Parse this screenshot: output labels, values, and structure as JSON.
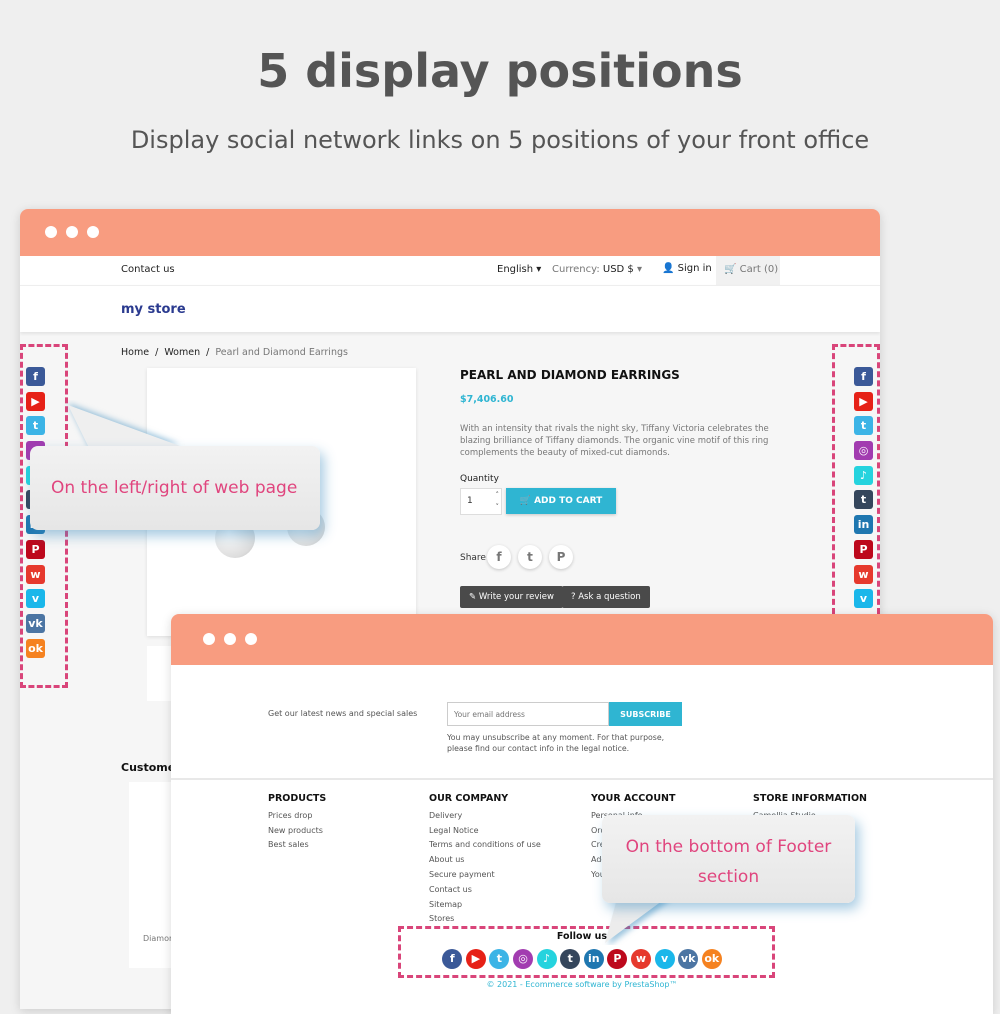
{
  "headline": {
    "title": "5 display positions",
    "subtitle": "Display social network links on 5 positions of your front office"
  },
  "colors": {
    "window_header": "#f89c80",
    "accent": "#2fb5d2",
    "callout_text": "#e0457e",
    "dash": "#d9457a"
  },
  "store": {
    "contact": "Contact us",
    "language": "English",
    "currency_label": "Currency:",
    "currency": "USD $",
    "sign_in": "Sign in",
    "cart": "Cart (0)",
    "logo": "my store",
    "breadcrumb": [
      "Home",
      "Women",
      "Pearl and Diamond Earrings"
    ],
    "product": {
      "name": "PEARL AND DIAMOND EARRINGS",
      "price": "$7,406.60",
      "description": "With an intensity that rivals the night sky, Tiffany Victoria celebrates the blazing brilliance of Tiffany diamonds. The organic vine motif of this ring complements the beauty of mixed-cut diamonds.",
      "quantity_label": "Quantity",
      "quantity": "1",
      "add_to_cart": "ADD TO CART",
      "share": "Share",
      "review": "Write your review",
      "ask": "Ask a question"
    },
    "customers_heading": "Custome",
    "product_card": "Diamon"
  },
  "callouts": {
    "side": "On the left/right of web page",
    "footer": "On the bottom of Footer section"
  },
  "footer": {
    "newsletter_label": "Get our latest news and special sales",
    "email_placeholder": "Your email address",
    "subscribe": "SUBSCRIBE",
    "newsletter_note": "You may unsubscribe at any moment. For that purpose, please find our contact info in the legal notice.",
    "columns": [
      {
        "title": "PRODUCTS",
        "items": [
          "Prices drop",
          "New products",
          "Best sales"
        ]
      },
      {
        "title": "OUR COMPANY",
        "items": [
          "Delivery",
          "Legal Notice",
          "Terms and conditions of use",
          "About us",
          "Secure payment",
          "Contact us",
          "Sitemap",
          "Stores"
        ]
      },
      {
        "title": "YOUR ACCOUNT",
        "items": [
          "Personal info",
          "Ord",
          "Cred",
          "Add",
          "You"
        ]
      },
      {
        "title": "STORE INFORMATION",
        "items": [
          "Camellia Studio",
          "",
          "nail.com"
        ]
      }
    ],
    "follow_us": "Follow us",
    "copyright": "© 2021 - Ecommerce software by PrestaShop™"
  },
  "social": [
    {
      "name": "facebook",
      "glyph": "f",
      "color": "#3b5998"
    },
    {
      "name": "youtube",
      "glyph": "▶",
      "color": "#e62117"
    },
    {
      "name": "twitter",
      "glyph": "t",
      "color": "#3cb4e6"
    },
    {
      "name": "instagram",
      "glyph": "◎",
      "color": "#a23cb0"
    },
    {
      "name": "tiktok",
      "glyph": "♪",
      "color": "#25d3de"
    },
    {
      "name": "tumblr",
      "glyph": "t",
      "color": "#35465c"
    },
    {
      "name": "linkedin",
      "glyph": "in",
      "color": "#1f77b0"
    },
    {
      "name": "pinterest",
      "glyph": "P",
      "color": "#bd081c"
    },
    {
      "name": "weibo",
      "glyph": "w",
      "color": "#e6392d"
    },
    {
      "name": "vimeo",
      "glyph": "v",
      "color": "#1ab7ea"
    },
    {
      "name": "vk",
      "glyph": "vk",
      "color": "#4c75a3"
    },
    {
      "name": "odnoklassniki",
      "glyph": "ok",
      "color": "#f58220"
    }
  ]
}
